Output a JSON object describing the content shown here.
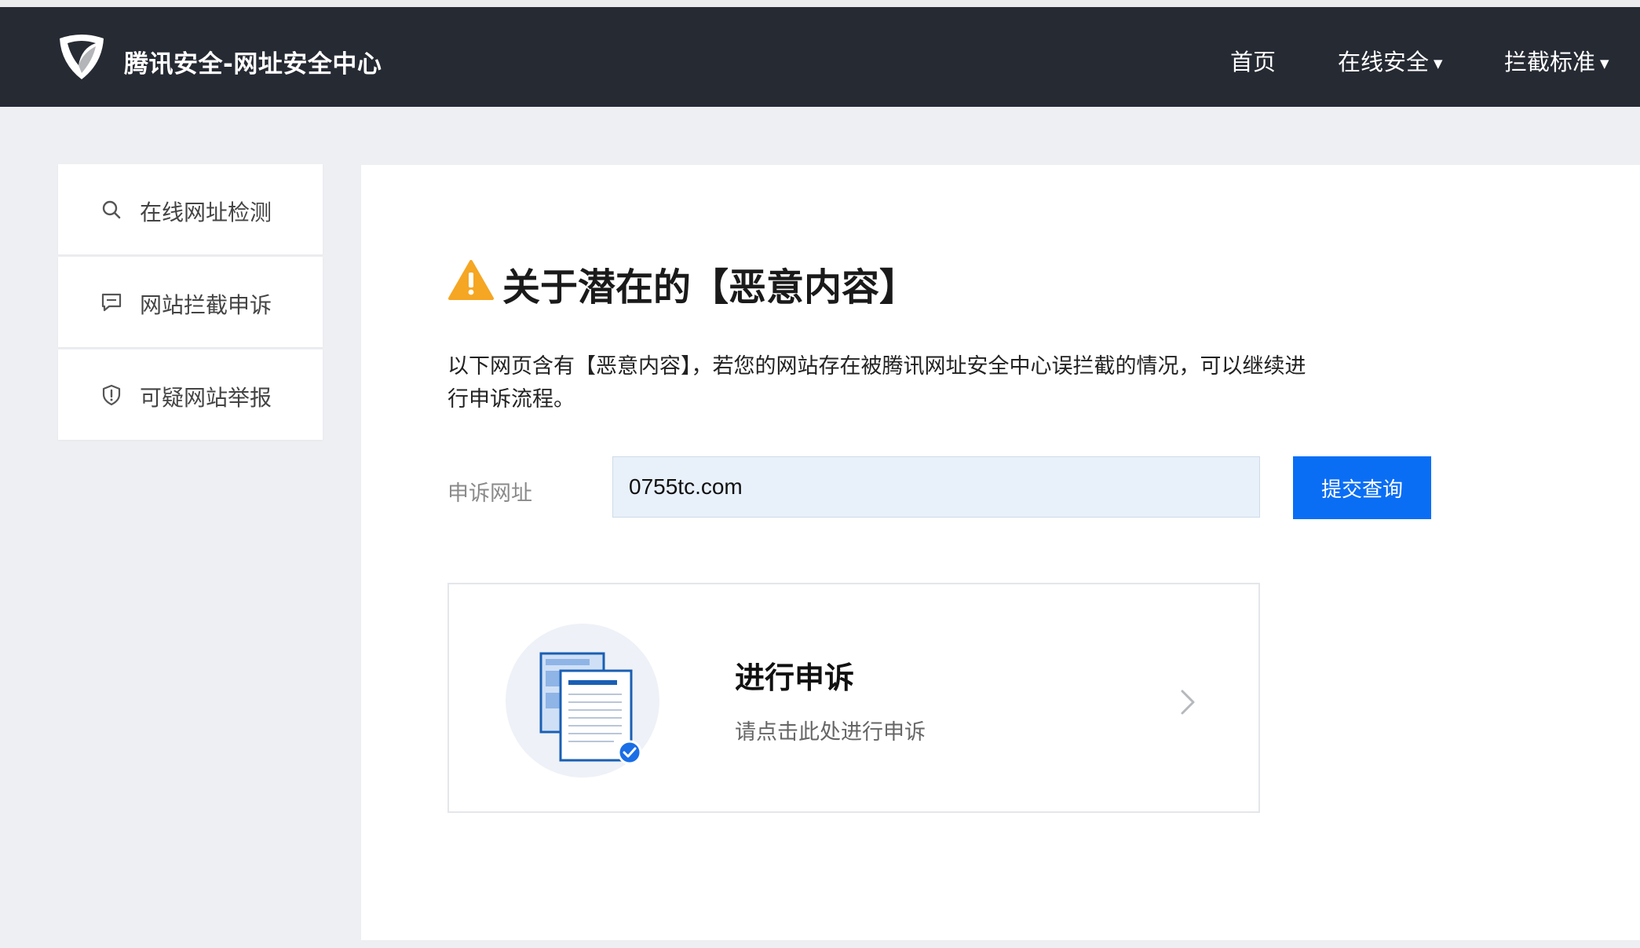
{
  "header": {
    "brand": "腾讯安全-网址安全中心",
    "logo_icon": "tencent-security-shield-icon",
    "nav": [
      {
        "label": "首页",
        "has_dropdown": false
      },
      {
        "label": "在线安全",
        "has_dropdown": true
      },
      {
        "label": "拦截标准",
        "has_dropdown": true
      }
    ],
    "dropdown_glyph": "▼",
    "background": "#262a33"
  },
  "sidebar": {
    "items": [
      {
        "label": "在线网址检测",
        "icon": "search-icon"
      },
      {
        "label": "网站拦截申诉",
        "icon": "message-icon"
      },
      {
        "label": "可疑网站举报",
        "icon": "shield-alert-icon"
      }
    ]
  },
  "main": {
    "title": "关于潜在的【恶意内容】",
    "warning_icon": "warning-icon",
    "warning_color": "#f5a623",
    "description": "以下网页含有【恶意内容】，若您的网站存在被腾讯网址安全中心误拦截的情况，可以继续进行申诉流程。",
    "form": {
      "label": "申诉网址",
      "url_value": "0755tc.com",
      "submit_label": "提交查询",
      "submit_color": "#0a6ef5"
    },
    "appeal_card": {
      "title": "进行申诉",
      "subtitle": "请点击此处进行申诉",
      "illustration": "document-check-icon",
      "arrow": "chevron-right-icon"
    }
  }
}
